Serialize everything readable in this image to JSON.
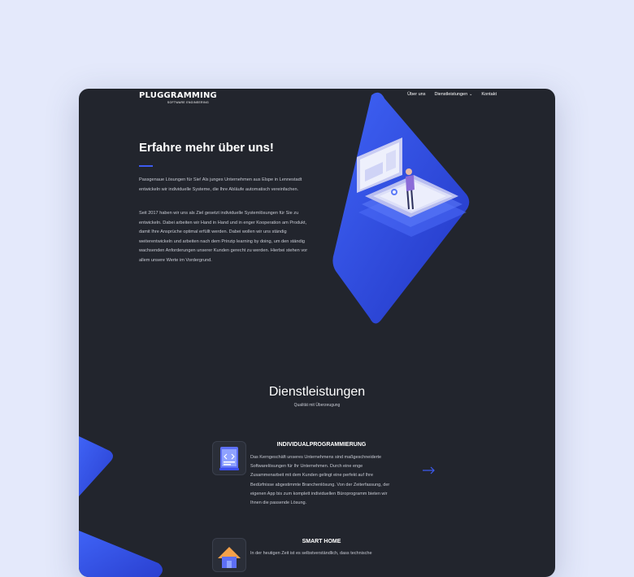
{
  "header": {
    "logo_text": "PLUGGRAMMING",
    "logo_tagline": "SOFTWARE ENGINEERING",
    "nav": [
      {
        "label": "Über uns"
      },
      {
        "label": "Dienstleistungen",
        "has_dropdown": true
      },
      {
        "label": "Kontakt"
      }
    ]
  },
  "about": {
    "title": "Erfahre mehr über uns!",
    "paragraph1": "Passgenaue Lösungen für Sie! Als junges Unternehmen aus Elspe in Lennestadt entwickeln wir individuelle Systeme, die Ihre Abläufe automatisch vereinfachen.",
    "paragraph2": "Seit 2017 haben wir uns als Ziel gesetzt individuelle Systemlösungen für Sie zu entwickeln. Dabei arbeiten wir Hand in Hand und in enger Kooperation am Produkt, damit Ihre Ansprüche optimal erfüllt werden. Dabei wollen wir uns ständig weiterentwickeln und arbeiten nach dem Prinzip learning by doing, um den ständig wachsenden Anforderungen unserer Kunden gerecht zu werden. Hierbei stehen vor allem unsere Werte im Vordergrund."
  },
  "services": {
    "title": "Dienstleistungen",
    "subtitle": "Qualität mit Überzeugung",
    "items": [
      {
        "heading": "INDIVIDUALPROGRAMMIERUNG",
        "icon": "code-window-icon",
        "text": "Das Kerngeschäft unseres Unternehmens sind maßgeschneiderte Softwarelösungen für Ihr Unternehmen. Durch eine enge Zusammenarbeit mit dem Kunden gelingt eine perfekt auf Ihre Bedürfnisse abgestimmte Branchenlösung. Von der Zeiterfassung, der eigenen App bis zum komplett individuellen Büroprogramm bieten wir Ihnen die passende Lösung."
      },
      {
        "heading": "SMART HOME",
        "icon": "smart-home-icon",
        "text": "In der heutigen Zeit ist es selbstverständlich, dass technische"
      }
    ]
  },
  "colors": {
    "background": "#e4e9fb",
    "card": "#22252d",
    "accent": "#3d5bf0"
  }
}
